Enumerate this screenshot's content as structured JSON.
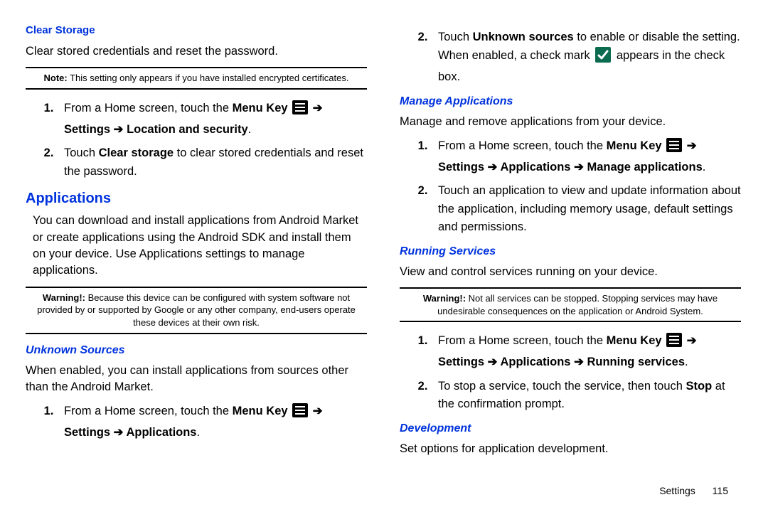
{
  "left": {
    "clearStorage": {
      "heading": "Clear Storage",
      "intro": "Clear stored credentials and reset the password.",
      "noteLabel": "Note:",
      "noteText": " This setting only appears if you have installed encrypted certificates.",
      "step1_a": "From a Home screen, touch the ",
      "step1_b": "Menu Key",
      "step1_c": " ➔ ",
      "step1_d": "Settings",
      "step1_e": " ➔ Location and security",
      "step1_f": ".",
      "step2_a": "Touch ",
      "step2_b": "Clear storage",
      "step2_c": " to clear stored credentials and reset the password."
    },
    "apps": {
      "heading": "Applications",
      "intro": "You can download and install applications from Android Market or create applications using the Android SDK and install them on your device. Use Applications settings to manage applications.",
      "warnLabel": "Warning!:",
      "warnText": " Because this device can be configured with system software not provided by or supported by Google or any other company, end-users operate these devices at their own risk."
    },
    "unknown": {
      "heading": "Unknown Sources",
      "intro": "When enabled, you can install applications from sources other than the Android Market.",
      "step1_a": "From a Home screen, touch the ",
      "step1_b": "Menu Key",
      "step1_c": " ➔ ",
      "step1_d": "Settings",
      "step1_e": " ➔ Applications",
      "step1_f": "."
    }
  },
  "right": {
    "unknownCont": {
      "step2_a": "Touch ",
      "step2_b": "Unknown sources",
      "step2_c": " to enable or disable the setting. When enabled, a check mark ",
      "step2_d": " appears in the check box."
    },
    "manage": {
      "heading": "Manage Applications",
      "intro": "Manage and remove applications from your device.",
      "step1_a": "From a Home screen, touch the ",
      "step1_b": "Menu Key",
      "step1_c": " ➔ ",
      "step1_d": "Settings",
      "step1_e": " ➔ Applications ➔ Manage applications",
      "step1_f": ".",
      "step2": "Touch an application to view and update information about the application, including memory usage, default settings and permissions."
    },
    "running": {
      "heading": "Running Services",
      "intro": "View and control services running on your device.",
      "warnLabel": "Warning!:",
      "warnText": " Not all services can be stopped. Stopping services may have undesirable consequences on the application or Android System.",
      "step1_a": "From a Home screen, touch the ",
      "step1_b": "Menu Key",
      "step1_c": " ➔ ",
      "step1_d": "Settings",
      "step1_e": " ➔ Applications ➔ Running services",
      "step1_f": ".",
      "step2_a": "To stop a service, touch the service, then touch ",
      "step2_b": "Stop",
      "step2_c": " at the confirmation prompt."
    },
    "dev": {
      "heading": "Development",
      "intro": "Set options for application development."
    }
  },
  "footer": {
    "section": "Settings",
    "page": "115"
  }
}
